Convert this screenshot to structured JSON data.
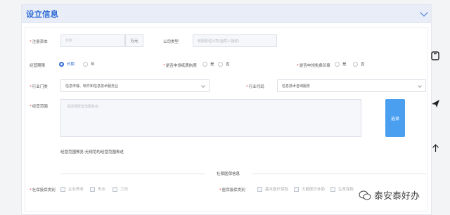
{
  "section": {
    "title": "设立信息"
  },
  "fields": {
    "registered_capital": {
      "label": "注册资本",
      "value": "100",
      "suffix": "万元"
    },
    "company_type": {
      "label": "公司类型",
      "value": "有限责任公司(自然人独资)"
    },
    "term": {
      "label": "经营期限",
      "options": [
        "长期",
        "年"
      ],
      "selected": "长期"
    },
    "paper_license": {
      "label": "是否申领纸质执照",
      "options": [
        "是",
        "否"
      ]
    },
    "free_seal": {
      "label": "是否申领免费印章",
      "options": [
        "是",
        "否"
      ]
    },
    "industry_category": {
      "label": "行业门类",
      "value": "信息传输、软件和信息技术服务业"
    },
    "industry_code": {
      "label": "行业代码",
      "value": "信息技术咨询服务"
    },
    "business_scope": {
      "label": "经营范围",
      "placeholder": "请选择经营范围条目",
      "button": "选择"
    },
    "scope_preview": "经营范围预览:无规范的经营范围表述"
  },
  "social": {
    "heading": "社保医保信息",
    "insurance_type": {
      "label": "社保投保类别",
      "options": [
        "企业养老",
        "失业",
        "工伤"
      ]
    },
    "medical_type": {
      "label": "医保投保类别",
      "options": [
        "基本医疗保险",
        "大额医疗补助",
        "生育保险"
      ]
    }
  },
  "watermark": "泰安泰好办",
  "colors": {
    "accent": "#2f6bd6",
    "button": "#4a9ff0",
    "required": "#e34545"
  },
  "icons": [
    "chevron-down-icon",
    "save-icon",
    "send-icon",
    "arrow-up-icon",
    "wechat-icon"
  ]
}
